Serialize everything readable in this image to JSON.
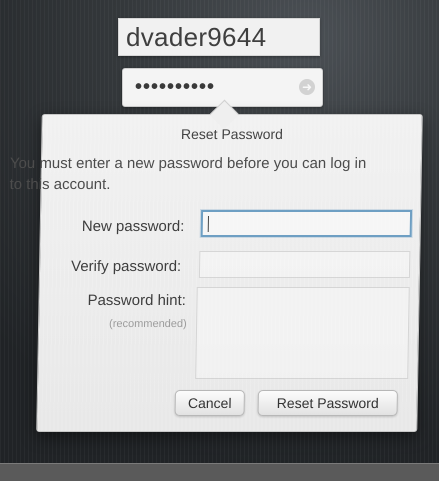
{
  "login": {
    "username": "dvader9644",
    "password_mask": "••••••••••",
    "submit_icon": "arrow-right-icon"
  },
  "reset_sheet": {
    "title": "Reset Password",
    "message": "You must enter a new password before you can log in to this account.",
    "new_password_label": "New password:",
    "verify_password_label": "Verify password:",
    "password_hint_label": "Password hint:",
    "recommended_label": "(recommended)",
    "cancel_label": "Cancel",
    "reset_label": "Reset Password"
  }
}
